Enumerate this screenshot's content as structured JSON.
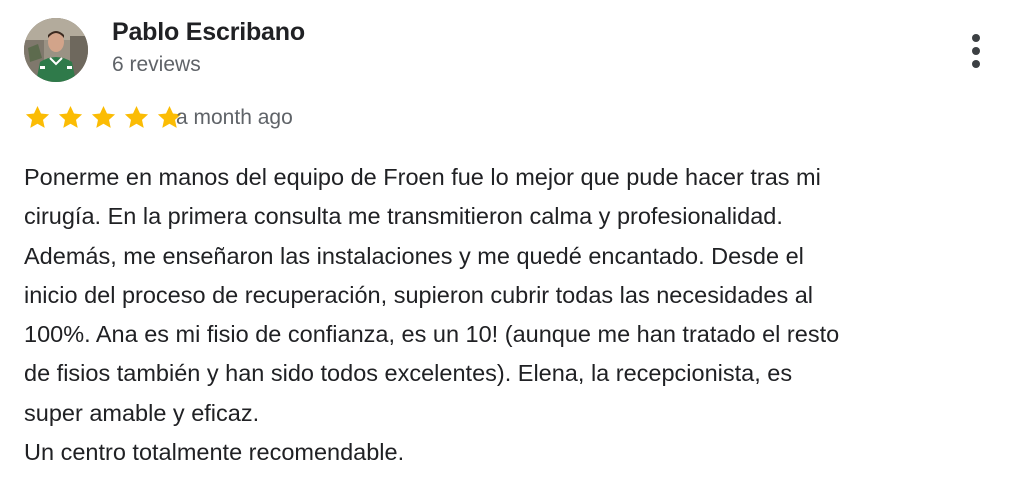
{
  "author": {
    "name": "Pablo Escribano",
    "meta": "6 reviews"
  },
  "rating": {
    "value": 5,
    "max": 5
  },
  "review": {
    "date": "a month ago",
    "lines": [
      "Ponerme en manos del equipo de Froen fue lo mejor que pude hacer tras mi",
      "cirugía. En la primera consulta me transmitieron calma y profesionalidad.",
      "Además, me enseñaron las instalaciones y me quedé encantado. Desde el",
      "inicio del proceso de recuperación, supieron cubrir todas las necesidades al",
      "100%. Ana es mi fisio de confianza, es un 10! (aunque me han tratado el resto",
      "de fisios también y han sido todos excelentes). Elena, la recepcionista, es",
      "super amable y eficaz.",
      "Un centro totalmente recomendable."
    ]
  },
  "colors": {
    "star": "#fbbc04",
    "name": "#202124",
    "secondary": "#5f6368",
    "icon": "#3c4043"
  },
  "icons": {
    "more": "more-vert-icon",
    "star": "star-icon"
  }
}
